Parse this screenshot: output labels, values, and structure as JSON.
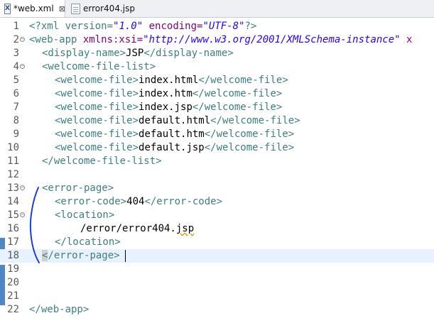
{
  "tabs": [
    {
      "label": "*web.xml",
      "close_glyph": "⊠",
      "icon": "xml-file-icon"
    },
    {
      "label": "error404.jsp",
      "icon": "jsp-file-icon"
    }
  ],
  "lines": {
    "1": {
      "n": "1",
      "p1": "<?xml version=",
      "p2": "\"1.0\"",
      "p3": " encoding=",
      "p4": "\"UTF-8\"",
      "p5": "?>"
    },
    "2": {
      "n": "2",
      "p1": "<web-app ",
      "p2": "xmlns:xsi=",
      "p3": "\"http://www.w3.org/2001/XMLSchema-instance\"",
      "p4": " x"
    },
    "3": {
      "n": "3",
      "p1": "<display-name>",
      "p2": "JSP",
      "p3": "</display-name>"
    },
    "4": {
      "n": "4",
      "p1": "<welcome-file-list>"
    },
    "5": {
      "n": "5",
      "p1": "<welcome-file>",
      "p2": "index.html",
      "p3": "</welcome-file>"
    },
    "6": {
      "n": "6",
      "p1": "<welcome-file>",
      "p2": "index.htm",
      "p3": "</welcome-file>"
    },
    "7": {
      "n": "7",
      "p1": "<welcome-file>",
      "p2": "index.jsp",
      "p3": "</welcome-file>"
    },
    "8": {
      "n": "8",
      "p1": "<welcome-file>",
      "p2": "default.html",
      "p3": "</welcome-file>"
    },
    "9": {
      "n": "9",
      "p1": "<welcome-file>",
      "p2": "default.htm",
      "p3": "</welcome-file>"
    },
    "10": {
      "n": "10",
      "p1": "<welcome-file>",
      "p2": "default.jsp",
      "p3": "</welcome-file>"
    },
    "11": {
      "n": "11",
      "p1": "</welcome-file-list>"
    },
    "12": {
      "n": "12"
    },
    "13": {
      "n": "13",
      "p1": "<error-page>"
    },
    "14": {
      "n": "14",
      "p1": "<error-code>",
      "p2": "404",
      "p3": "</error-code>"
    },
    "15": {
      "n": "15",
      "p1": "<location>"
    },
    "16": {
      "n": "16",
      "p1": "/error/error404.",
      "p2": "jsp"
    },
    "17": {
      "n": "17",
      "p1": "</location>"
    },
    "18": {
      "n": "18",
      "p1": "<",
      "p2": "/error-page>"
    },
    "19": {
      "n": "19"
    },
    "20": {
      "n": "20"
    },
    "21": {
      "n": "21"
    },
    "22": {
      "n": "22",
      "p1": "</web-app>"
    }
  },
  "fold_glyph": "−",
  "colors": {
    "tag": "#3f7f7f",
    "attribute": "#7f007f",
    "value": "#2a00ff",
    "text": "#000000",
    "annotation_pen": "#1a3fd6",
    "change_marker": "#4f86c6"
  }
}
